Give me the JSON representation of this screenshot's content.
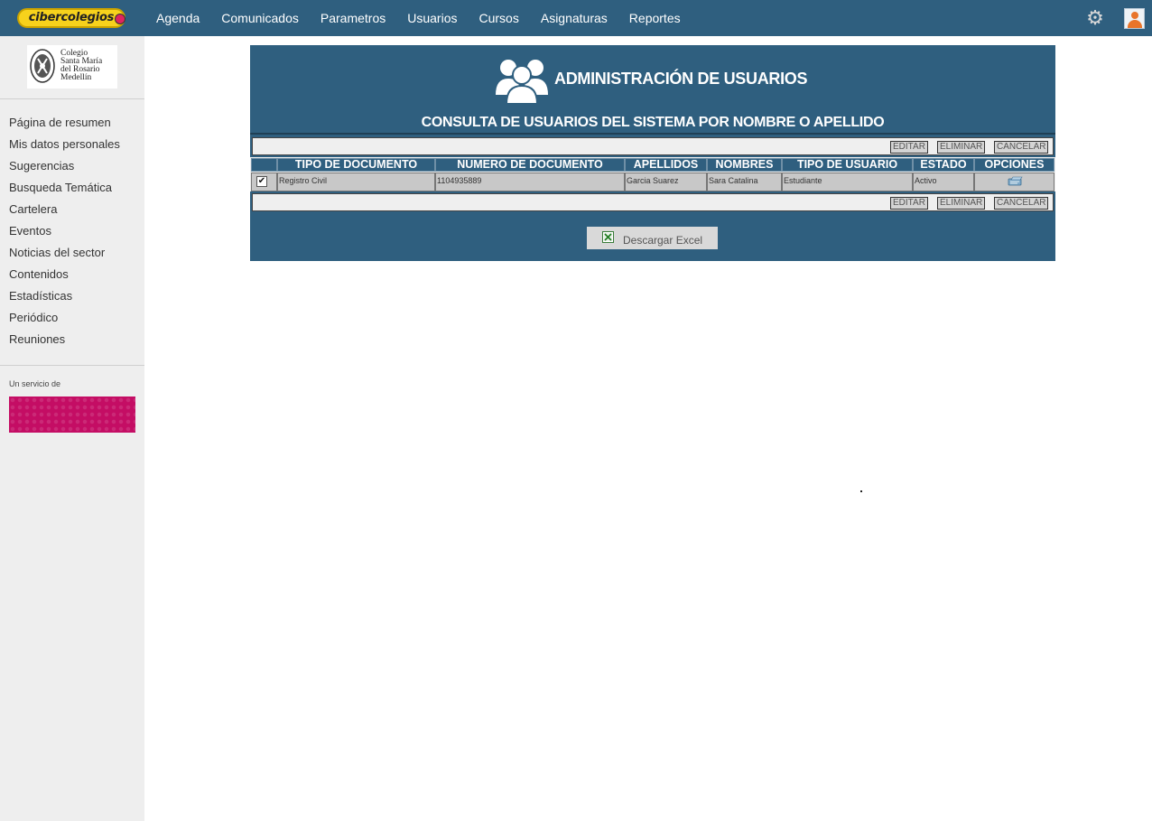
{
  "topbar": {
    "logo_text": "cibercolegios",
    "nav": [
      "Agenda",
      "Comunicados",
      "Parametros",
      "Usuarios",
      "Cursos",
      "Asignaturas",
      "Reportes"
    ],
    "icons": {
      "settings": "gear-icon",
      "user": "user-avatar-icon"
    }
  },
  "sidebar": {
    "school_name": [
      "Colegio",
      "Santa María",
      "del Rosario",
      "Medellín"
    ],
    "menu": [
      "Página de resumen",
      "Mis datos personales",
      "Sugerencias",
      "Busqueda Temática",
      "Cartelera",
      "Eventos",
      "Noticias del sector",
      "Contenidos",
      "Estadísticas",
      "Periódico",
      "Reuniones"
    ],
    "service_label": "Un servicio de",
    "banner_color": "#c40d64"
  },
  "panel": {
    "title": "ADMINISTRACIÓN DE USUARIOS",
    "subtitle": "CONSULTA DE USUARIOS DEL SISTEMA POR NOMBRE O APELLIDO",
    "actions": {
      "edit": "EDITAR",
      "delete": "ELIMINAR",
      "cancel": "CANCELAR"
    },
    "table": {
      "headers": [
        "TIPO DE DOCUMENTO",
        "NÚMERO DE DOCUMENTO",
        "APELLIDOS",
        "NOMBRES",
        "TIPO DE USUARIO",
        "ESTADO",
        "OPCIONES"
      ],
      "rows": [
        {
          "checked": true,
          "doc_type": "Registro Civil",
          "doc_number": "1104935889",
          "last_names": "Garcia Suarez",
          "first_names": "Sara Catalina",
          "user_type": "Estudiante",
          "status": "Activo",
          "options_icon": "edit-icon"
        }
      ]
    },
    "download_label": "Descargar Excel",
    "colors": {
      "panel": "#2f5f7f",
      "header_cell": "#2f5f7f",
      "row": "#c8c8c8"
    }
  }
}
